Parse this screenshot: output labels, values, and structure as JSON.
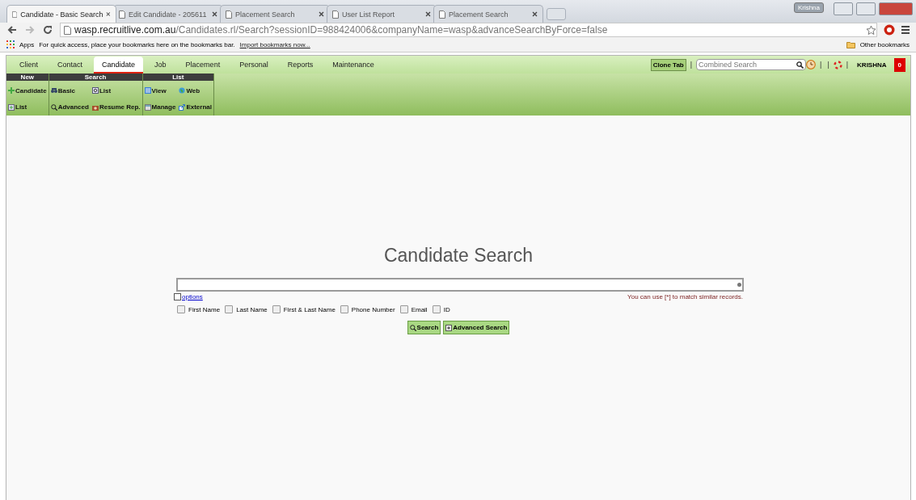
{
  "browser": {
    "tabs": [
      {
        "title": "Candidate - Basic Search",
        "selected": true
      },
      {
        "title": "Edit Candidate - 205611",
        "selected": false
      },
      {
        "title": "Placement Search",
        "selected": false
      },
      {
        "title": "User List Report",
        "selected": false
      },
      {
        "title": "Placement Search",
        "selected": false
      }
    ],
    "profile": "Krishna",
    "url_host": "wasp.recruitlive.com.au",
    "url_path": "/Candidates.rl/Search?sessionID=988424006&companyName=wasp&advanceSearchByForce=false",
    "bookmarks_bar": {
      "apps": "Apps",
      "message": "For quick access, place your bookmarks here on the bookmarks bar.",
      "import_link": "Import bookmarks now...",
      "other": "Other bookmarks"
    }
  },
  "nav": {
    "tabs": [
      {
        "label": "Client",
        "selected": false
      },
      {
        "label": "Contact",
        "selected": false
      },
      {
        "label": "Candidate",
        "selected": true
      },
      {
        "label": "Job",
        "selected": false
      },
      {
        "label": "Placement",
        "selected": false
      },
      {
        "label": "Personal",
        "selected": false
      },
      {
        "label": "Reports",
        "selected": false
      },
      {
        "label": "Maintenance",
        "selected": false
      }
    ],
    "clone_button": "Clone Tab",
    "separators": [
      "|",
      "|",
      "|",
      "|"
    ],
    "search_placeholder": "Combined Search",
    "user": "KRISHNA",
    "badge": "0"
  },
  "ribbon": [
    {
      "title": "New",
      "items": [
        "Candidate",
        "List"
      ]
    },
    {
      "title": "Search",
      "items": [
        "Basic",
        "List",
        "Advanced",
        "Resume Rep."
      ]
    },
    {
      "title": "List",
      "items": [
        "View",
        "Web",
        "Manage",
        "External"
      ]
    }
  ],
  "search": {
    "title": "Candidate Search",
    "options_link": "options",
    "hint": "You can use [*] to match similar records.",
    "filters": [
      {
        "label": "First Name",
        "checked": false
      },
      {
        "label": "Last Name",
        "checked": false
      },
      {
        "label": "First & Last Name",
        "checked": false
      },
      {
        "label": "Phone Number",
        "checked": false
      },
      {
        "label": "Email",
        "checked": false
      },
      {
        "label": "ID",
        "checked": false
      }
    ],
    "buttons": [
      "Search",
      "Advanced Search"
    ]
  }
}
